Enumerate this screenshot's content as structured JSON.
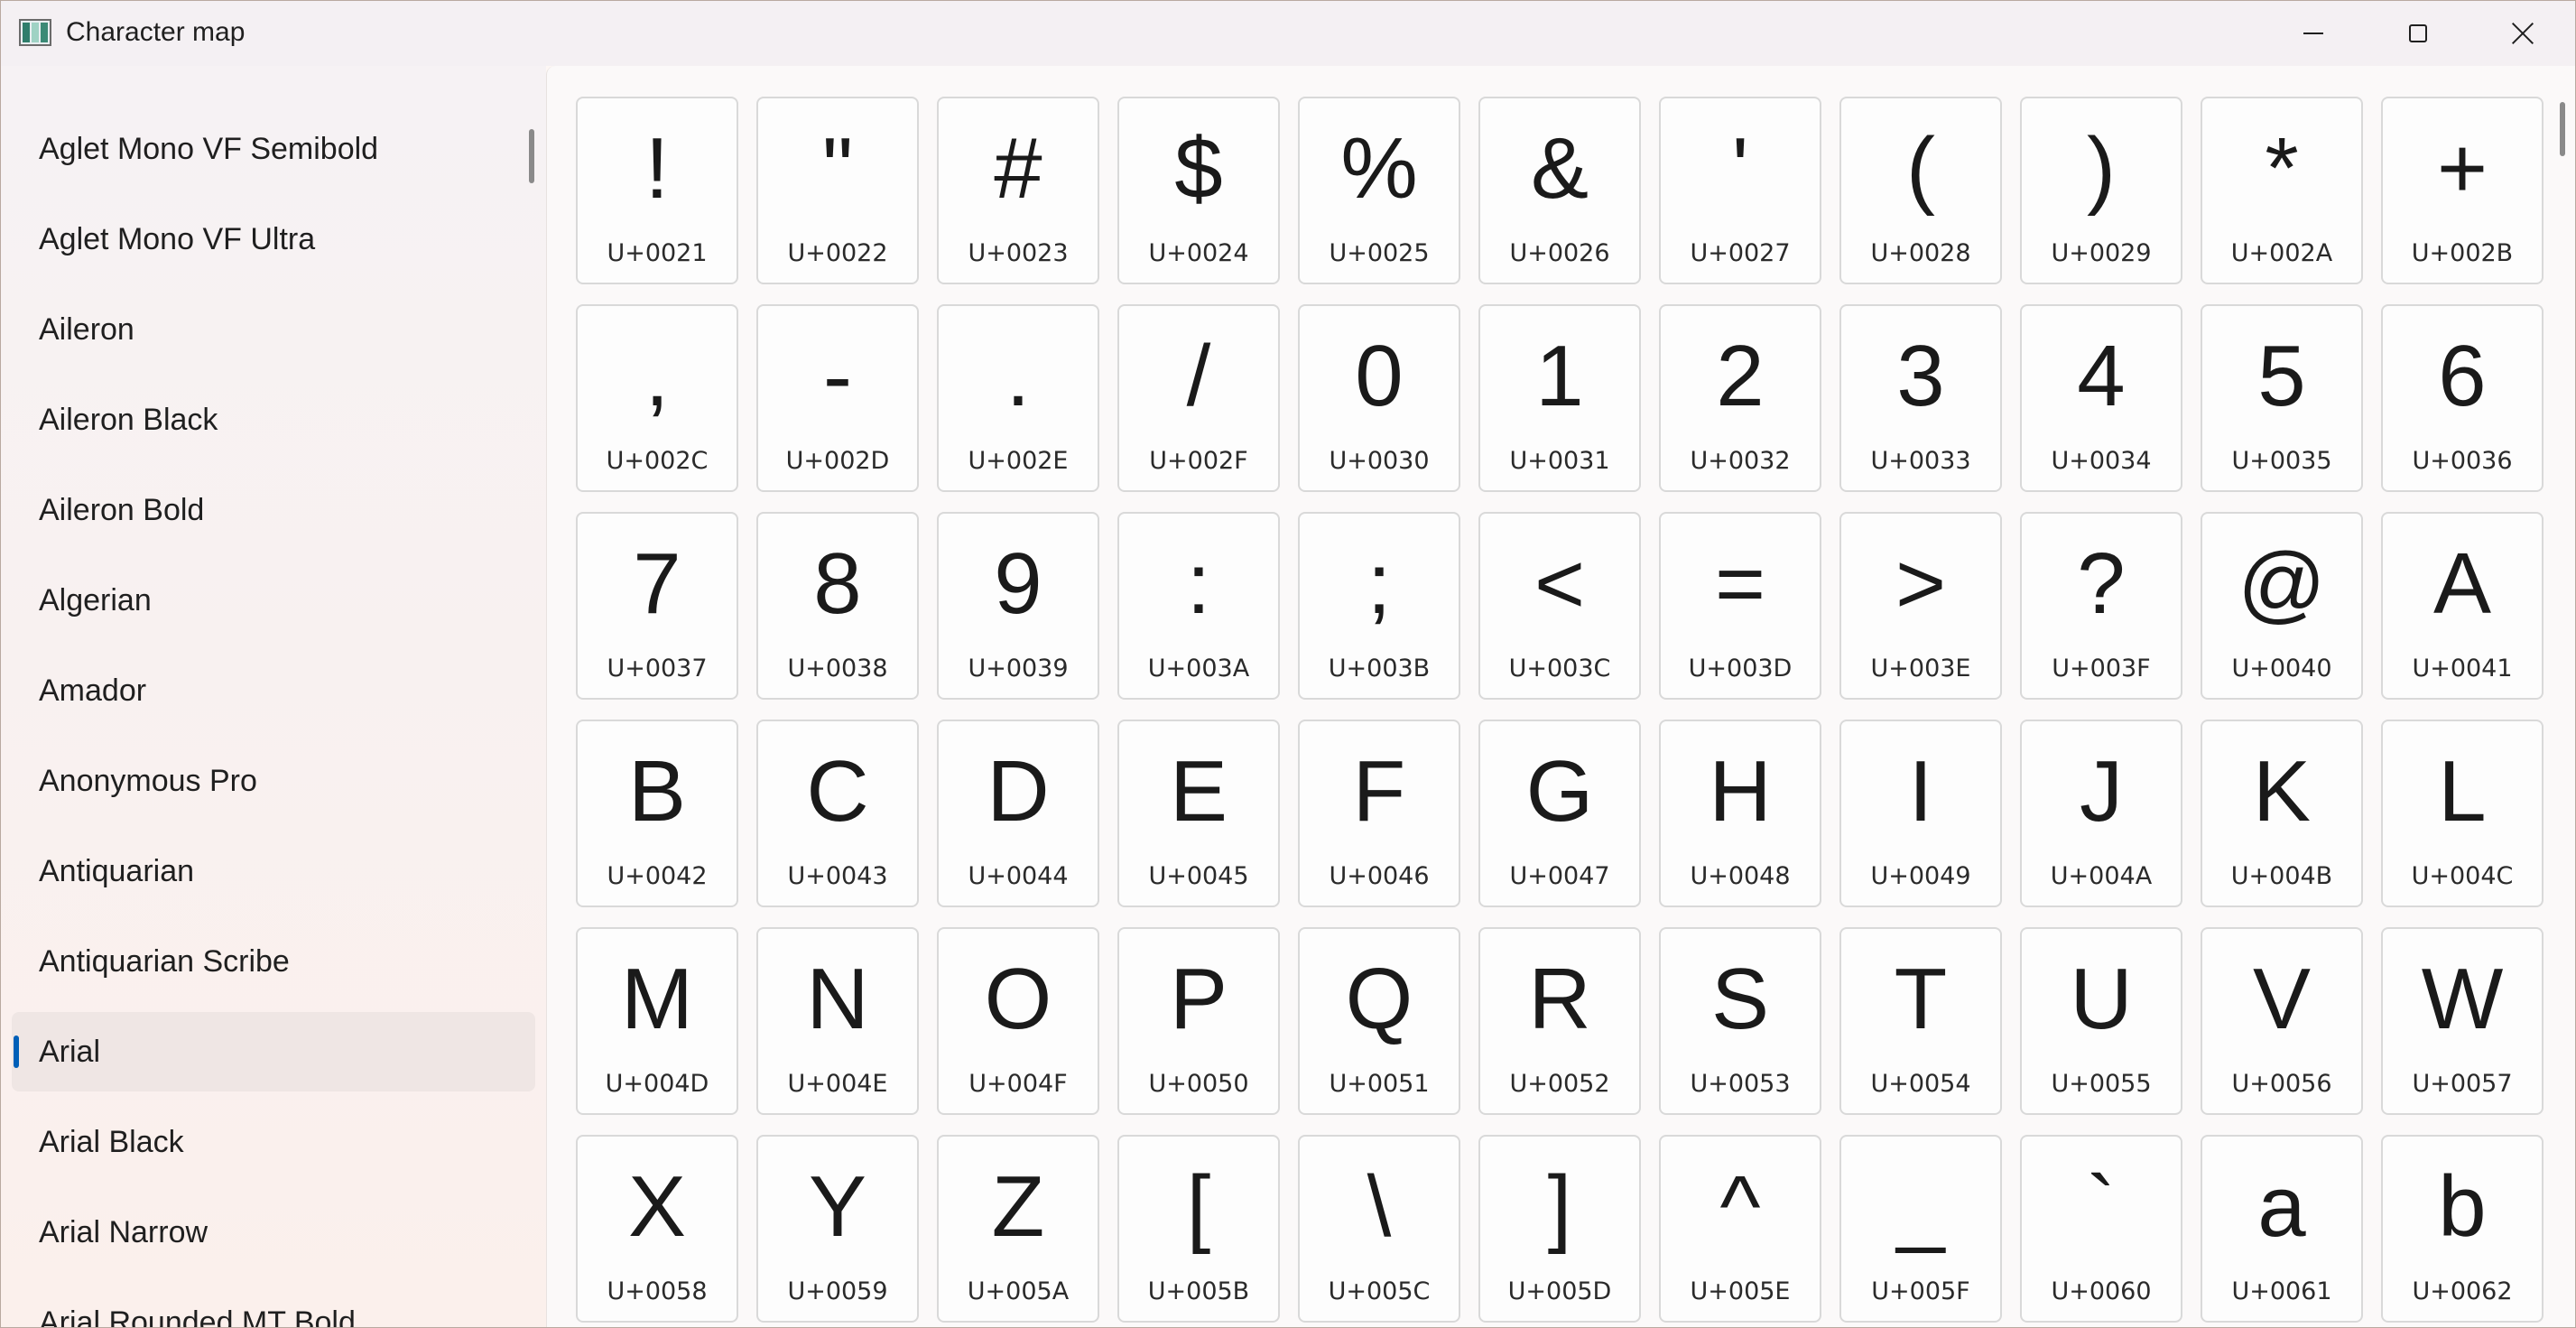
{
  "window": {
    "title": "Character map",
    "icon": "character-map-app-icon",
    "controls": [
      "minimize-icon",
      "maximize-icon",
      "close-icon"
    ]
  },
  "sidebar": {
    "selected": "Arial",
    "accent_color": "#005fb8",
    "fonts": [
      "Aglet Mono VF Semibold",
      "Aglet Mono VF Ultra",
      "Aileron",
      "Aileron Black",
      "Aileron Bold",
      "Algerian",
      "Amador",
      "Anonymous Pro",
      "Antiquarian",
      "Antiquarian Scribe",
      "Arial",
      "Arial Black",
      "Arial Narrow",
      "Arial Rounded MT Bold"
    ]
  },
  "characters": [
    {
      "glyph": "!",
      "code": "U+0021"
    },
    {
      "glyph": "\"",
      "code": "U+0022"
    },
    {
      "glyph": "#",
      "code": "U+0023"
    },
    {
      "glyph": "$",
      "code": "U+0024"
    },
    {
      "glyph": "%",
      "code": "U+0025"
    },
    {
      "glyph": "&",
      "code": "U+0026"
    },
    {
      "glyph": "'",
      "code": "U+0027"
    },
    {
      "glyph": "(",
      "code": "U+0028"
    },
    {
      "glyph": ")",
      "code": "U+0029"
    },
    {
      "glyph": "*",
      "code": "U+002A"
    },
    {
      "glyph": "+",
      "code": "U+002B"
    },
    {
      "glyph": ",",
      "code": "U+002C"
    },
    {
      "glyph": "-",
      "code": "U+002D"
    },
    {
      "glyph": ".",
      "code": "U+002E"
    },
    {
      "glyph": "/",
      "code": "U+002F"
    },
    {
      "glyph": "0",
      "code": "U+0030"
    },
    {
      "glyph": "1",
      "code": "U+0031"
    },
    {
      "glyph": "2",
      "code": "U+0032"
    },
    {
      "glyph": "3",
      "code": "U+0033"
    },
    {
      "glyph": "4",
      "code": "U+0034"
    },
    {
      "glyph": "5",
      "code": "U+0035"
    },
    {
      "glyph": "6",
      "code": "U+0036"
    },
    {
      "glyph": "7",
      "code": "U+0037"
    },
    {
      "glyph": "8",
      "code": "U+0038"
    },
    {
      "glyph": "9",
      "code": "U+0039"
    },
    {
      "glyph": ":",
      "code": "U+003A"
    },
    {
      "glyph": ";",
      "code": "U+003B"
    },
    {
      "glyph": "<",
      "code": "U+003C"
    },
    {
      "glyph": "=",
      "code": "U+003D"
    },
    {
      "glyph": ">",
      "code": "U+003E"
    },
    {
      "glyph": "?",
      "code": "U+003F"
    },
    {
      "glyph": "@",
      "code": "U+0040"
    },
    {
      "glyph": "A",
      "code": "U+0041"
    },
    {
      "glyph": "B",
      "code": "U+0042"
    },
    {
      "glyph": "C",
      "code": "U+0043"
    },
    {
      "glyph": "D",
      "code": "U+0044"
    },
    {
      "glyph": "E",
      "code": "U+0045"
    },
    {
      "glyph": "F",
      "code": "U+0046"
    },
    {
      "glyph": "G",
      "code": "U+0047"
    },
    {
      "glyph": "H",
      "code": "U+0048"
    },
    {
      "glyph": "I",
      "code": "U+0049"
    },
    {
      "glyph": "J",
      "code": "U+004A"
    },
    {
      "glyph": "K",
      "code": "U+004B"
    },
    {
      "glyph": "L",
      "code": "U+004C"
    },
    {
      "glyph": "M",
      "code": "U+004D"
    },
    {
      "glyph": "N",
      "code": "U+004E"
    },
    {
      "glyph": "O",
      "code": "U+004F"
    },
    {
      "glyph": "P",
      "code": "U+0050"
    },
    {
      "glyph": "Q",
      "code": "U+0051"
    },
    {
      "glyph": "R",
      "code": "U+0052"
    },
    {
      "glyph": "S",
      "code": "U+0053"
    },
    {
      "glyph": "T",
      "code": "U+0054"
    },
    {
      "glyph": "U",
      "code": "U+0055"
    },
    {
      "glyph": "V",
      "code": "U+0056"
    },
    {
      "glyph": "W",
      "code": "U+0057"
    },
    {
      "glyph": "X",
      "code": "U+0058"
    },
    {
      "glyph": "Y",
      "code": "U+0059"
    },
    {
      "glyph": "Z",
      "code": "U+005A"
    },
    {
      "glyph": "[",
      "code": "U+005B"
    },
    {
      "glyph": "\\",
      "code": "U+005C"
    },
    {
      "glyph": "]",
      "code": "U+005D"
    },
    {
      "glyph": "^",
      "code": "U+005E"
    },
    {
      "glyph": "_",
      "code": "U+005F"
    },
    {
      "glyph": "`",
      "code": "U+0060"
    },
    {
      "glyph": "a",
      "code": "U+0061"
    },
    {
      "glyph": "b",
      "code": "U+0062"
    }
  ]
}
